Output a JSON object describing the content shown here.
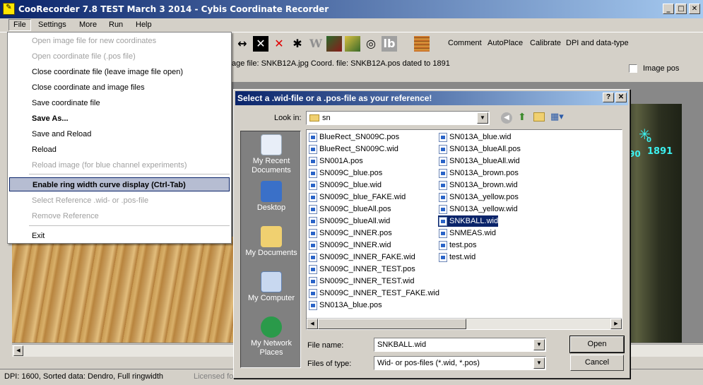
{
  "window": {
    "title": "CooRecorder 7.8 TEST March 3 2014 - Cybis Coordinate Recorder",
    "min": "_",
    "max": "□",
    "close": "✕"
  },
  "menubar": [
    "File",
    "Settings",
    "More",
    "Run",
    "Help"
  ],
  "toolbar": {
    "texts": [
      "Comment",
      "AutoPlace",
      "Calibrate",
      "DPI and data-type"
    ],
    "icon_w": "W",
    "icon_lb": "lb"
  },
  "infobar": {
    "text": "age file: SNKB12A.jpg  Coord. file: SNKB12A.pos dated to 1891",
    "image_pos_label": "Image pos"
  },
  "file_menu": {
    "items": [
      {
        "label": "Open image file for new coordinates",
        "disabled": true
      },
      {
        "label": "Open coordinate file (.pos file)",
        "disabled": true
      },
      {
        "label": "Close coordinate file (leave image file open)"
      },
      {
        "label": "Close coordinate and image files"
      },
      {
        "label": "Save coordinate file"
      },
      {
        "label": "Save As...",
        "bold": true
      },
      {
        "label": "Save and Reload"
      },
      {
        "label": "Reload"
      },
      {
        "label": "Reload image (for blue channel experiments)",
        "disabled": true
      },
      {
        "label": "Enable ring width curve display (Ctrl-Tab)",
        "highlighted": true
      },
      {
        "label": "Select Reference .wid- or .pos-file",
        "disabled": true
      },
      {
        "label": "Remove Reference",
        "disabled": true
      },
      {
        "label": "Exit"
      }
    ]
  },
  "image": {
    "marker_year": "1891",
    "marker_prev": "90",
    "marker_index": "0"
  },
  "dialog": {
    "title": "Select a .wid-file or a .pos-file as your reference!",
    "help": "?",
    "close": "✕",
    "look_in_label": "Look in:",
    "look_in_value": "sn",
    "places": [
      "My Recent Documents",
      "Desktop",
      "My Documents",
      "My Computer",
      "My Network Places"
    ],
    "files_col1": [
      "BlueRect_SN009C.pos",
      "BlueRect_SN009C.wid",
      "SN001A.pos",
      "SN009C_blue.pos",
      "SN009C_blue.wid",
      "SN009C_blue_FAKE.wid",
      "SN009C_blueAll.pos",
      "SN009C_blueAll.wid",
      "SN009C_INNER.pos",
      "SN009C_INNER.wid",
      "SN009C_INNER_FAKE.wid",
      "SN009C_INNER_TEST.pos",
      "SN009C_INNER_TEST.wid",
      "SN009C_INNER_TEST_FAKE.wid",
      "SN013A_blue.pos"
    ],
    "files_col2": [
      "SN013A_blue.wid",
      "SN013A_blueAll.pos",
      "SN013A_blueAll.wid",
      "SN013A_brown.pos",
      "SN013A_brown.wid",
      "SN013A_yellow.pos",
      "SN013A_yellow.wid",
      "SNKBALL.wid",
      "SNMEAS.wid",
      "test.pos",
      "test.wid"
    ],
    "selected_file": "SNKBALL.wid",
    "file_name_label": "File name:",
    "file_name_value": "SNKBALL.wid",
    "files_of_type_label": "Files of type:",
    "files_of_type_value": "Wid- or pos-files (*.wid, *.pos)",
    "open_button": "Open",
    "cancel_button": "Cancel"
  },
  "status": {
    "left": "DPI: 1600,   Sorted data: Dendro, Full ringwidth",
    "right": "Licensed fo"
  }
}
